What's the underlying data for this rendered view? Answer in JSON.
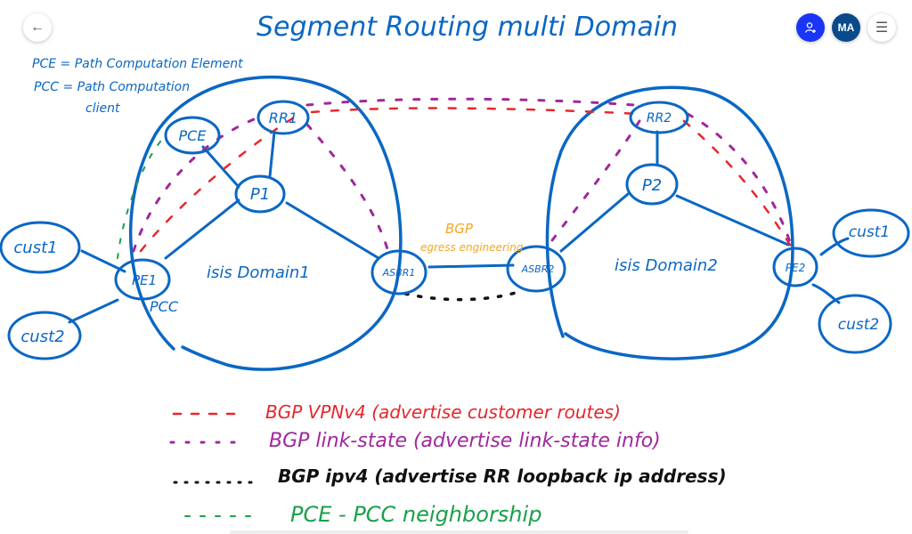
{
  "toolbar": {
    "back_icon": "arrow-left",
    "share_icon": "person-add",
    "avatar_initials": "MA",
    "menu_icon": "hamburger"
  },
  "colors": {
    "ink_blue": "#0a67c4",
    "bgp_vpnv4_red": "#e8262c",
    "bgp_ls_purple": "#a0289c",
    "bgp_ipv4_black": "#111111",
    "pce_pcc_green": "#1aa04a",
    "annotation_orange": "#f5a623",
    "share_blue": "#1a35f5",
    "avatar_navy": "#0a4a8a"
  },
  "diagram": {
    "title": "Segment Routing multi Domain",
    "definitions": [
      "PCE = Path Computation Element",
      "PCC = Path Computation",
      "client"
    ],
    "nodes": {
      "pce": "PCE",
      "rr1": "RR1",
      "p1": "P1",
      "pe1": "PE1",
      "asbr1": "ASBR1",
      "asbr2": "ASBR2",
      "rr2": "RR2",
      "p2": "P2",
      "pe2": "PE2",
      "cust1_left": "cust1",
      "cust2_left": "cust2",
      "cust1_right": "cust1",
      "cust2_right": "cust2"
    },
    "labels": {
      "pcc": "PCC",
      "domain1": "isis Domain1",
      "domain2": "isis Domain2",
      "bgp_lsp_line1": "BGP",
      "bgp_lsp_line2": "egress engineering"
    },
    "legend": [
      {
        "style": "dashed-red",
        "text": "BGP VPNv4 (advertise customer routes)"
      },
      {
        "style": "dotted-purple",
        "text": "BGP link-state (advertise link-state info)"
      },
      {
        "style": "dotted-black",
        "text": "BGP ipv4 (advertise RR loopback ip address)"
      },
      {
        "style": "dashed-green",
        "text": "PCE - PCC neighborship"
      }
    ]
  }
}
